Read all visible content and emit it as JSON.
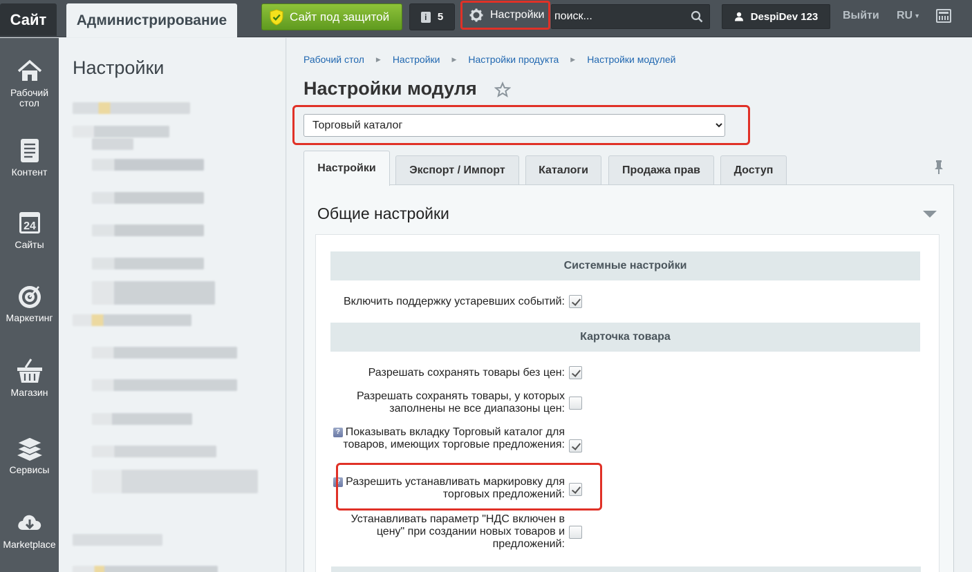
{
  "topbar": {
    "site_tab": "Сайт",
    "admin_tab": "Администрирование",
    "protected_label": "Сайт под защитой",
    "notifications_count": "5",
    "settings_label": "Настройки",
    "search_placeholder": "поиск...",
    "user_name": "DespiDev 123",
    "logout_label": "Выйти",
    "lang_label": "RU"
  },
  "leftmenu": {
    "items": [
      {
        "label": "Рабочий стол",
        "icon": "home-icon"
      },
      {
        "label": "Контент",
        "icon": "document-icon"
      },
      {
        "label": "Сайты",
        "icon": "calendar-24-icon"
      },
      {
        "label": "Маркетинг",
        "icon": "target-icon"
      },
      {
        "label": "Магазин",
        "icon": "basket-icon"
      },
      {
        "label": "Сервисы",
        "icon": "layers-icon"
      },
      {
        "label": "Marketplace",
        "icon": "cloud-download-icon"
      }
    ]
  },
  "panel2": {
    "title": "Настройки"
  },
  "main": {
    "breadcrumbs": [
      "Рабочий стол",
      "Настройки",
      "Настройки продукта",
      "Настройки модулей"
    ],
    "title": "Настройки модуля",
    "module_selected": "Торговый каталог",
    "tabs": [
      "Настройки",
      "Экспорт / Импорт",
      "Каталоги",
      "Продажа прав",
      "Доступ"
    ],
    "section_title": "Общие настройки",
    "groups": [
      {
        "title": "Системные настройки"
      },
      {
        "title": "Карточка товара"
      }
    ],
    "options": [
      {
        "label": "Включить поддержку устаревших событий:",
        "checked": true,
        "help": false
      },
      {
        "label": "Разрешать сохранять товары без цен:",
        "checked": true,
        "help": false
      },
      {
        "label": "Разрешать сохранять товары, у которых заполнены не все диапазоны цен:",
        "checked": false,
        "help": false
      },
      {
        "label": "Показывать вкладку Торговый каталог для товаров, имеющих торговые предложения:",
        "checked": true,
        "help": true
      },
      {
        "label": "Разрешить устанавливать маркировку для торговых предложений:",
        "checked": true,
        "help": true
      },
      {
        "label": "Устанавливать параметр \"НДС включен в цену\" при создании новых товаров и предложений:",
        "checked": false,
        "help": false
      }
    ],
    "help_glyph": "?"
  },
  "colors": {
    "topbar_bg": "#4b5258",
    "highlight_red": "#e03127",
    "link_blue": "#2067b0",
    "protected_green": "#6fae28"
  }
}
